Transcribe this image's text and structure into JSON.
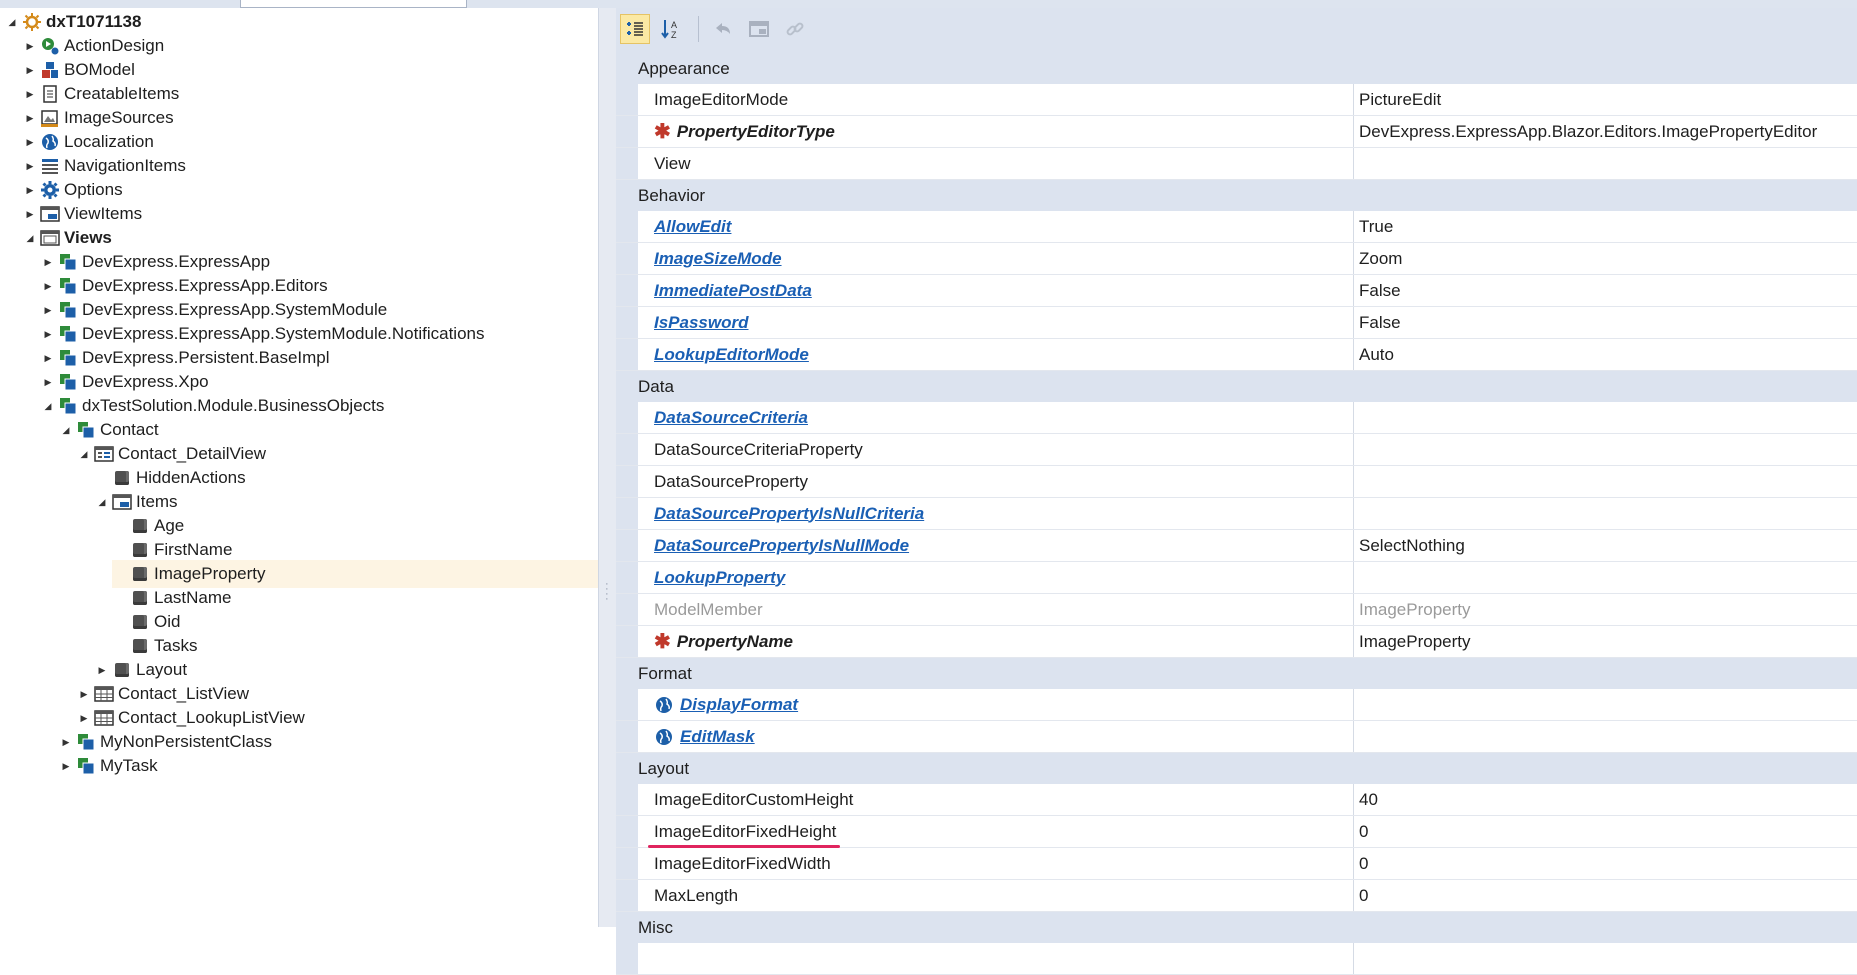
{
  "tree": {
    "root": "dxT1071138",
    "top_items": [
      "ActionDesign",
      "BOModel",
      "CreatableItems",
      "ImageSources",
      "Localization",
      "NavigationItems",
      "Options",
      "ViewItems"
    ],
    "views_label": "Views",
    "namespaces": [
      "DevExpress.ExpressApp",
      "DevExpress.ExpressApp.Editors",
      "DevExpress.ExpressApp.SystemModule",
      "DevExpress.ExpressApp.SystemModule.Notifications",
      "DevExpress.Persistent.BaseImpl",
      "DevExpress.Xpo",
      "dxTestSolution.Module.BusinessObjects"
    ],
    "contact": "Contact",
    "detail_view": "Contact_DetailView",
    "hidden_actions": "HiddenActions",
    "items_label": "Items",
    "items": [
      "Age",
      "FirstName",
      "ImageProperty",
      "LastName",
      "Oid",
      "Tasks"
    ],
    "selected_item": "ImageProperty",
    "layout": "Layout",
    "list_view": "Contact_ListView",
    "lookup_list_view": "Contact_LookupListView",
    "other_classes": [
      "MyNonPersistentClass",
      "MyTask"
    ]
  },
  "grid": {
    "categories": {
      "appearance": "Appearance",
      "behavior": "Behavior",
      "data": "Data",
      "format": "Format",
      "layout": "Layout",
      "misc": "Misc"
    },
    "appearance": [
      {
        "name": "ImageEditorMode",
        "value": "PictureEdit"
      },
      {
        "name": "PropertyEditorType",
        "value": "DevExpress.ExpressApp.Blazor.Editors.ImagePropertyEditor"
      },
      {
        "name": "View",
        "value": ""
      }
    ],
    "behavior": [
      {
        "name": "AllowEdit",
        "value": "True"
      },
      {
        "name": "ImageSizeMode",
        "value": "Zoom"
      },
      {
        "name": "ImmediatePostData",
        "value": "False"
      },
      {
        "name": "IsPassword",
        "value": "False"
      },
      {
        "name": "LookupEditorMode",
        "value": "Auto"
      }
    ],
    "data": [
      {
        "name": "DataSourceCriteria",
        "value": ""
      },
      {
        "name": "DataSourceCriteriaProperty",
        "value": ""
      },
      {
        "name": "DataSourceProperty",
        "value": ""
      },
      {
        "name": "DataSourcePropertyIsNullCriteria",
        "value": ""
      },
      {
        "name": "DataSourcePropertyIsNullMode",
        "value": "SelectNothing"
      },
      {
        "name": "LookupProperty",
        "value": ""
      },
      {
        "name": "ModelMember",
        "value": "ImageProperty"
      },
      {
        "name": "PropertyName",
        "value": "ImageProperty"
      }
    ],
    "format": [
      {
        "name": "DisplayFormat",
        "value": ""
      },
      {
        "name": "EditMask",
        "value": ""
      }
    ],
    "layout": [
      {
        "name": "ImageEditorCustomHeight",
        "value": "40"
      },
      {
        "name": "ImageEditorFixedHeight",
        "value": "0"
      },
      {
        "name": "ImageEditorFixedWidth",
        "value": "0"
      },
      {
        "name": "MaxLength",
        "value": "0"
      }
    ]
  },
  "colors": {
    "link": "#1a5fb4",
    "required_star": "#c0392b",
    "highlight_underline": "#e0245e",
    "selection": "#fdf4e3",
    "panel": "#dce3ef"
  }
}
